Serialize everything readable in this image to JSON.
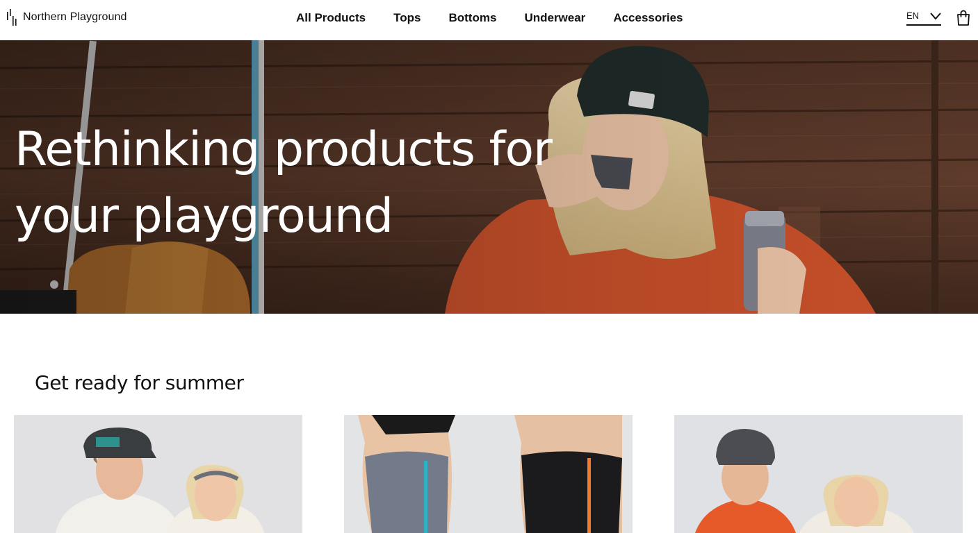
{
  "brand": {
    "name": "Northern Playground",
    "logo_icon": "bars-logo-icon"
  },
  "nav": {
    "items": [
      {
        "label": "All Products"
      },
      {
        "label": "Tops"
      },
      {
        "label": "Bottoms"
      },
      {
        "label": "Underwear"
      },
      {
        "label": "Accessories"
      }
    ]
  },
  "header": {
    "language": "EN",
    "language_icon": "chevron-down-icon",
    "cart_icon": "shopping-bag-icon"
  },
  "hero": {
    "title_line_1": "Rethinking products for",
    "title_line_2": "your playground",
    "image": "woman-drinking-from-thermos-cup"
  },
  "section": {
    "title": "Get ready for summer",
    "products": [
      {
        "image": "man-in-cap-and-woman-with-headband"
      },
      {
        "image": "two-people-in-base-layer-leggings"
      },
      {
        "image": "man-in-beanie-and-smiling-woman"
      }
    ]
  },
  "colors": {
    "text": "#111111",
    "hero_text": "#ffffff",
    "accent_orange": "#c8502a",
    "wood_brown": "#5a3a2a"
  }
}
